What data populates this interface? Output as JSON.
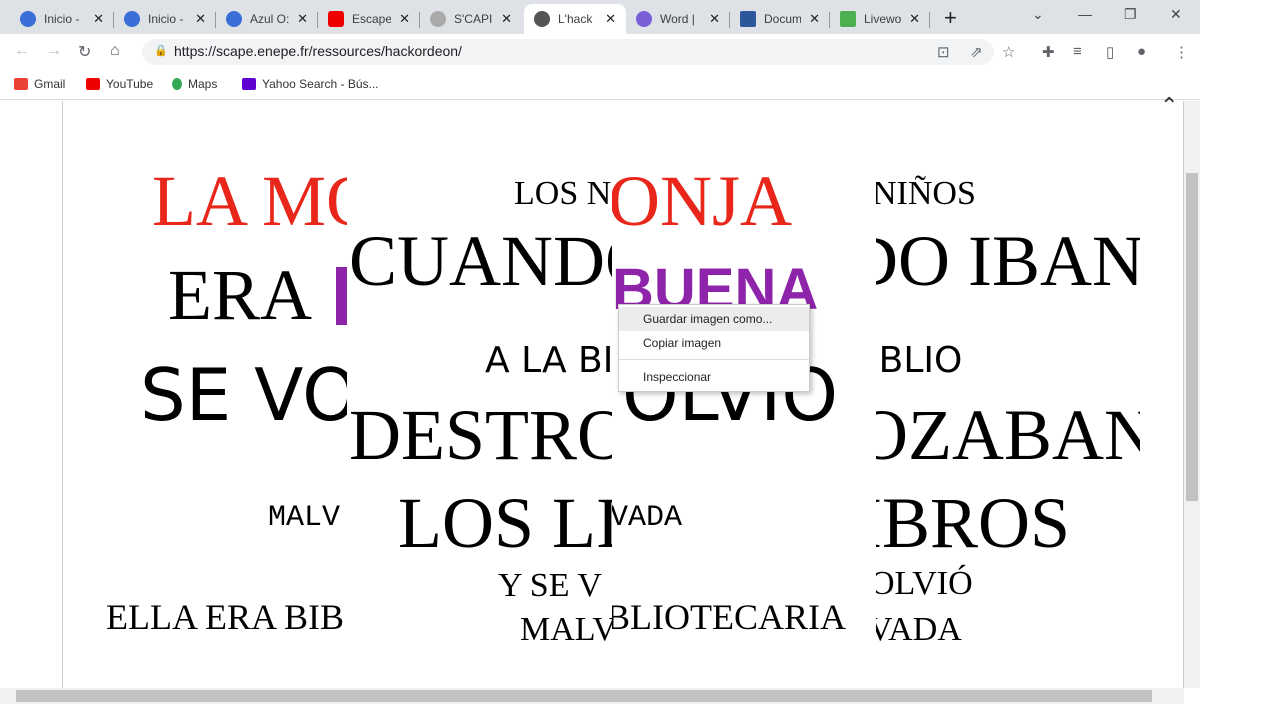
{
  "tabs": [
    {
      "label": "Inicio -",
      "color": "#3b6fd8"
    },
    {
      "label": "Inicio -",
      "color": "#3b6fd8"
    },
    {
      "label": "Azul O:",
      "color": "#3b6fd8"
    },
    {
      "label": "Escape",
      "color": "#e00"
    },
    {
      "label": "S'CAPI",
      "color": "#888"
    },
    {
      "label": "L'hack",
      "color": "#555"
    },
    {
      "label": "Word |",
      "color": "#7a5fd8"
    },
    {
      "label": "Docum",
      "color": "#2b579a"
    },
    {
      "label": "Livewo",
      "color": "#4caf50"
    }
  ],
  "url": "https://scape.enepe.fr/ressources/hackordeon/",
  "bookmarks": [
    "Gmail",
    "YouTube",
    "Maps",
    "Yahoo Search - Bús..."
  ],
  "words": {
    "c1": [
      "LA MO",
      "ERA ",
      "SE VO",
      "MALV",
      "ELLA ERA BIB"
    ],
    "c2": [
      "LOS N",
      "CUANDO",
      "A LA BI",
      "DESTRO",
      "LOS LI",
      "Y SE V",
      "MALV"
    ],
    "c3": [
      "ONJA",
      "BUENA",
      "OLVIO",
      "VADA",
      "BLIOTECARIA"
    ],
    "c4": [
      "NIÑOS",
      "DO IBAN",
      "IBLIO",
      "OZABAN",
      "IBROS",
      "OLVIÓ",
      "VADA"
    ]
  },
  "context_menu": [
    "Guardar imagen como...",
    "Copiar imagen",
    "Inspeccionar"
  ],
  "colors": {
    "red": "#e8261a",
    "purple": "#8e24aa"
  }
}
